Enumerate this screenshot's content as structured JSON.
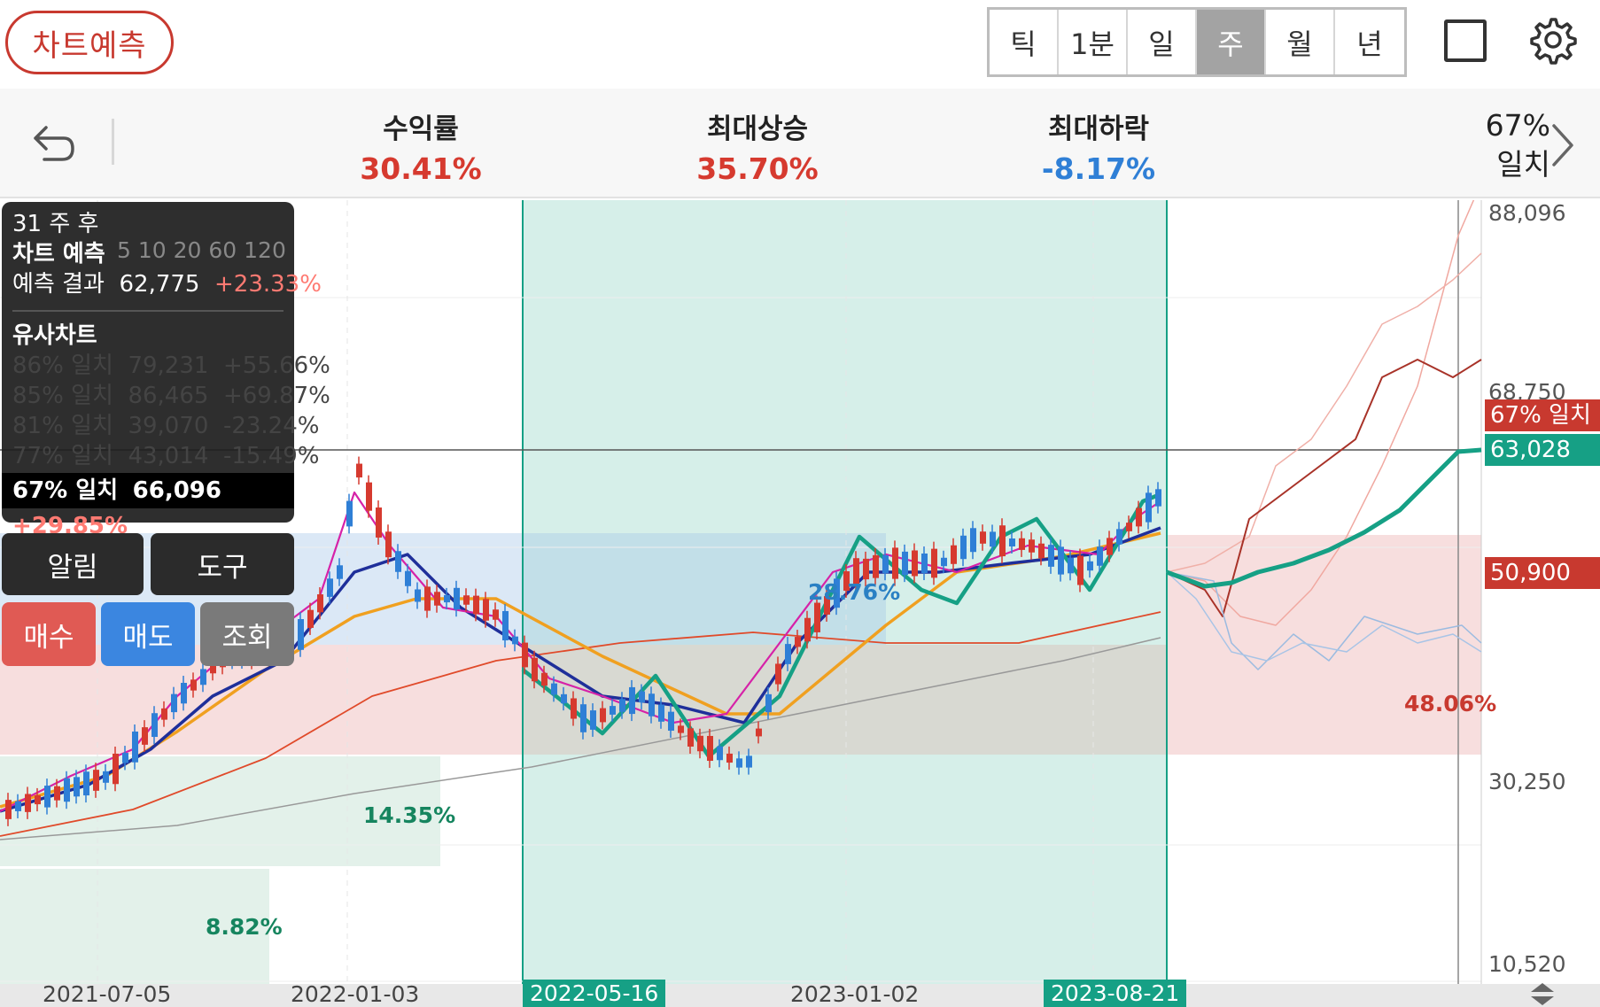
{
  "top": {
    "predict_button": "차트예측",
    "periods": [
      "틱",
      "1분",
      "일",
      "주",
      "월",
      "년"
    ],
    "active_period": "주"
  },
  "stats": {
    "return_label": "수익률",
    "return_value": "30.41%",
    "max_up_label": "최대상승",
    "max_up_value": "35.70%",
    "max_down_label": "최대하락",
    "max_down_value": "-8.17%",
    "match_pct": "67%",
    "match_label": "일치"
  },
  "info": {
    "weeks_after": "31 주 후",
    "title": "차트 예측",
    "result_label": "예측 결과",
    "result_price": "62,775",
    "result_change": "+23.33%",
    "similar_title": "유사차트",
    "similar": [
      {
        "match": "86% 일치",
        "price": "79,231",
        "change": "+55.66%"
      },
      {
        "match": "85% 일치",
        "price": "86,465",
        "change": "+69.87%"
      },
      {
        "match": "81% 일치",
        "price": "39,070",
        "change": "-23.24%"
      },
      {
        "match": "77% 일치",
        "price": "43,014",
        "change": "-15.49%"
      }
    ],
    "selected": {
      "match": "67% 일치",
      "price": "66,096",
      "change": "+29.85%"
    },
    "legend_partial": "5  10  20  60  120"
  },
  "buttons": {
    "alarm": "알림",
    "tools": "도구",
    "buy": "매수",
    "sell": "매도",
    "view": "조회"
  },
  "axis": {
    "prices": [
      "88,096",
      "68,750",
      "30,250",
      "10,520"
    ],
    "labels": {
      "match": "67% 일치",
      "current": "63,028",
      "close": "50,900"
    },
    "dates": [
      "2021-07-05",
      "2022-01-03",
      "2022-05-16",
      "2023-01-02",
      "2023-08-21"
    ]
  },
  "annotations": {
    "a1": "28.76%",
    "a2": "14.35%",
    "a3": "8.82%",
    "a4": "48.06%"
  },
  "colors": {
    "up": "#d63a2f",
    "down": "#2f7fd6",
    "accent": "#16a085"
  }
}
